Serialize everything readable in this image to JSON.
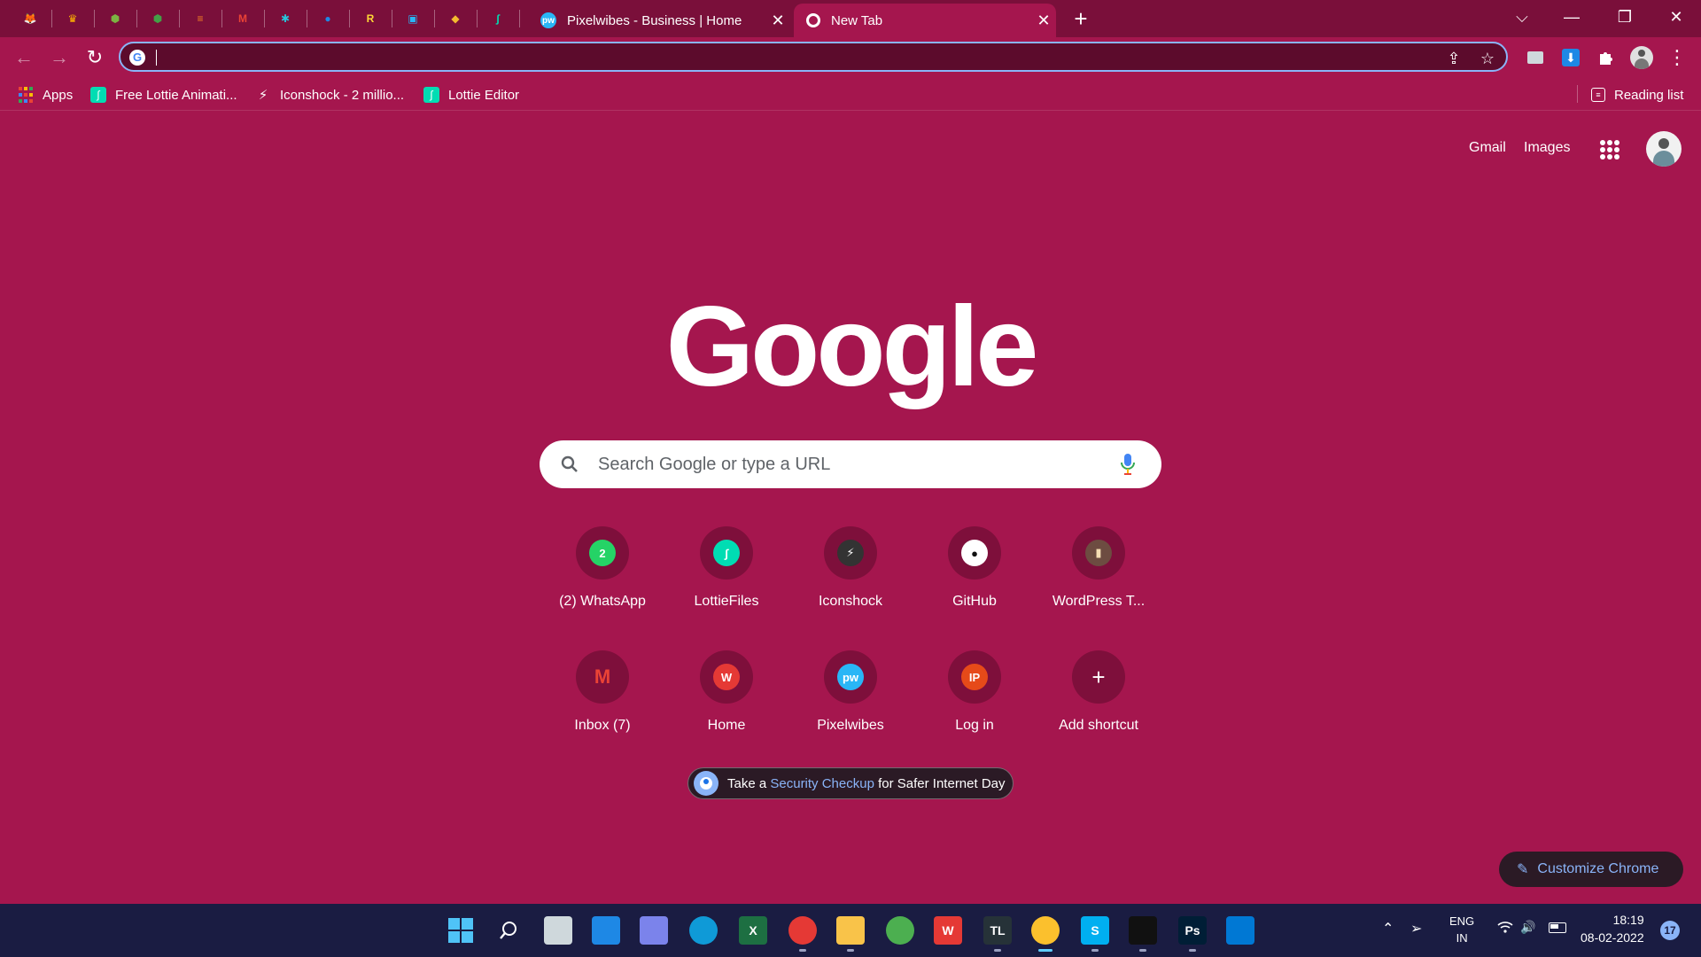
{
  "tabs": {
    "pinned": [
      {
        "icon": "gitlab-icon",
        "color": "#fc6d26",
        "glyph": "🦊"
      },
      {
        "icon": "brave-lion-icon",
        "color": "#ffb300",
        "glyph": "♛"
      },
      {
        "icon": "green-hexagon-icon",
        "color": "#7cb342",
        "glyph": "⬢"
      },
      {
        "icon": "green-hexagon-icon",
        "color": "#43a047",
        "glyph": "⬢"
      },
      {
        "icon": "stackoverflow-icon",
        "color": "#f48024",
        "glyph": "≡"
      },
      {
        "icon": "gmail-icon",
        "color": "#ea4335",
        "glyph": "M"
      },
      {
        "icon": "gear-icon",
        "color": "#26c6da",
        "glyph": "✱"
      },
      {
        "icon": "blue-circle-icon",
        "color": "#1e88e5",
        "glyph": "●"
      },
      {
        "icon": "yellow-r-icon",
        "color": "#fdd835",
        "glyph": "R"
      },
      {
        "icon": "box-icon",
        "color": "#29b6f6",
        "glyph": "▣"
      },
      {
        "icon": "binance-icon",
        "color": "#f3ba2f",
        "glyph": "◆"
      },
      {
        "icon": "lottie-icon",
        "color": "#00ddb3",
        "glyph": "∫"
      }
    ],
    "items": [
      {
        "title": "Pixelwibes - Business | Home",
        "close": "✕"
      },
      {
        "title": "New Tab",
        "close": "✕"
      }
    ],
    "new_tab": "+"
  },
  "window_controls": {
    "dropdown": "⌵",
    "minimize": "—",
    "maximize": "❐",
    "close": "✕"
  },
  "toolbar": {
    "back": "←",
    "forward": "→",
    "reload": "↻",
    "omnibox_value": "",
    "share": "⇪",
    "star": "☆",
    "menu": "⋮"
  },
  "bookmarks": {
    "items": [
      {
        "label": "Apps",
        "icon": "apps-grid-icon"
      },
      {
        "label": "Free Lottie Animati...",
        "icon": "lottie-icon"
      },
      {
        "label": "Iconshock - 2 millio...",
        "icon": "iconshock-icon"
      },
      {
        "label": "Lottie Editor",
        "icon": "lottie-icon"
      }
    ],
    "reading_list": "Reading list"
  },
  "ntp": {
    "gmail": "Gmail",
    "images": "Images",
    "logo": "Google",
    "search_placeholder": "Search Google or type a URL",
    "shortcuts": [
      {
        "label": "(2) WhatsApp",
        "glyph": "2",
        "bg": "#25d366",
        "fg": "#fff"
      },
      {
        "label": "LottieFiles",
        "glyph": "∫",
        "bg": "#00ddb3",
        "fg": "#fff"
      },
      {
        "label": "Iconshock",
        "glyph": "⚡",
        "bg": "#333",
        "fg": "#fff"
      },
      {
        "label": "GitHub",
        "glyph": "●",
        "bg": "#fff",
        "fg": "#111"
      },
      {
        "label": "WordPress T...",
        "glyph": "▮",
        "bg": "#6d4c41",
        "fg": "#f5deb3"
      },
      {
        "label": "Inbox (7)",
        "glyph": "M",
        "bg": "transparent",
        "fg": "#ea4335"
      },
      {
        "label": "Home",
        "glyph": "W",
        "bg": "#e53935",
        "fg": "#fff"
      },
      {
        "label": "Pixelwibes",
        "glyph": "pw",
        "bg": "#29b6f6",
        "fg": "#fff"
      },
      {
        "label": "Log in",
        "glyph": "IP",
        "bg": "#e64a19",
        "fg": "#fff"
      },
      {
        "label": "Add shortcut",
        "glyph": "+",
        "bg": "transparent",
        "fg": "#fff"
      }
    ],
    "promo": {
      "prefix": "Take a ",
      "link": "Security Checkup",
      "suffix": " for Safer Internet Day"
    },
    "customize": "Customize Chrome"
  },
  "taskbar": {
    "apps": [
      {
        "icon": "windows-start-icon",
        "bg": "#3d9bfa"
      },
      {
        "icon": "search-icon",
        "bg": "transparent"
      },
      {
        "icon": "task-view-icon",
        "bg": "#cfd8dc"
      },
      {
        "icon": "widgets-icon",
        "bg": "#1e88e5"
      },
      {
        "icon": "teams-chat-icon",
        "bg": "#7b83eb"
      },
      {
        "icon": "edge-icon",
        "bg": "#0f9ad7"
      },
      {
        "icon": "excel-icon",
        "bg": "#1d6f42",
        "glyph": "X"
      },
      {
        "icon": "chrome-profile-icon",
        "bg": "#e53935"
      },
      {
        "icon": "file-explorer-icon",
        "bg": "#f9c349"
      },
      {
        "icon": "chrome-icon",
        "bg": "#4caf50"
      },
      {
        "icon": "wps-office-icon",
        "bg": "#e53935",
        "glyph": "W"
      },
      {
        "icon": "textlab-icon",
        "bg": "#263238",
        "glyph": "TL"
      },
      {
        "icon": "chrome-active-icon",
        "bg": "#fbc02d"
      },
      {
        "icon": "skype-icon",
        "bg": "#00aff0",
        "glyph": "S"
      },
      {
        "icon": "terminal-icon",
        "bg": "#111"
      },
      {
        "icon": "photoshop-icon",
        "bg": "#001e36",
        "glyph": "Ps"
      },
      {
        "icon": "vscode-icon",
        "bg": "#0078d4"
      }
    ],
    "lang_top": "ENG",
    "lang_bottom": "IN",
    "time": "18:19",
    "date": "08-02-2022",
    "notifications": "17"
  }
}
